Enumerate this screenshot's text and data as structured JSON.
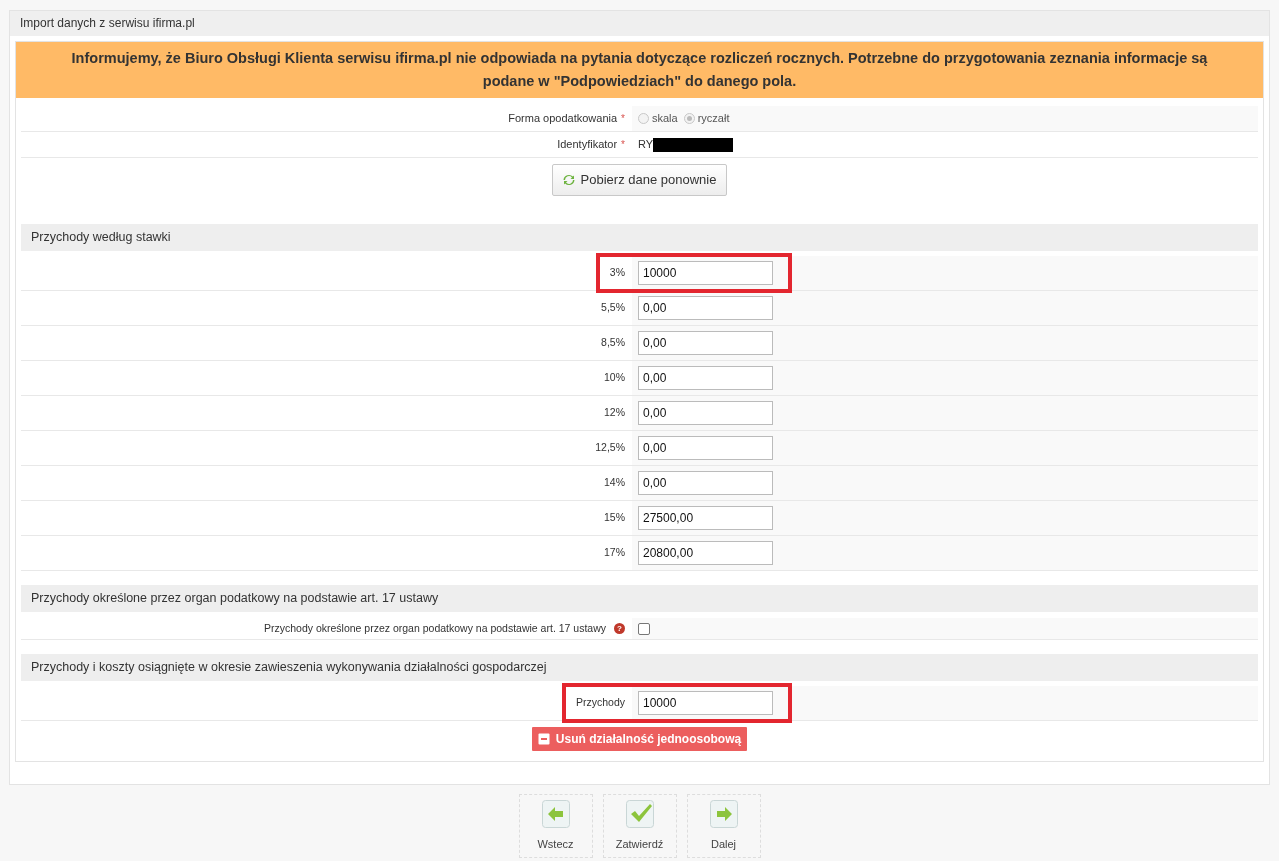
{
  "panel": {
    "title": "Import danych z serwisu ifirma.pl"
  },
  "notice": "Informujemy, że Biuro Obsługi Klienta serwisu ifirma.pl nie odpowiada na pytania dotyczące rozliczeń rocznych. Potrzebne do przygotowania zeznania informacje są podane w \"Podpowiedziach\" do danego pola.",
  "taxation": {
    "label": "Forma opodatkowania",
    "required_mark": "*",
    "options": [
      {
        "label": "skala",
        "selected": false
      },
      {
        "label": "ryczałt",
        "selected": true
      }
    ],
    "disabled": true
  },
  "identifier": {
    "label": "Identyfikator",
    "required_mark": "*",
    "value": "RY",
    "redacted": true
  },
  "refresh_button": "Pobierz dane ponownie",
  "sections": [
    {
      "title": "Przychody według stawki",
      "rows": [
        {
          "kind": "input",
          "label": "3%",
          "value": "10000",
          "highlighted": true
        },
        {
          "kind": "input",
          "label": "5,5%",
          "value": "0,00",
          "highlighted": false
        },
        {
          "kind": "input",
          "label": "8,5%",
          "value": "0,00",
          "highlighted": false
        },
        {
          "kind": "input",
          "label": "10%",
          "value": "0,00",
          "highlighted": false
        },
        {
          "kind": "input",
          "label": "12%",
          "value": "0,00",
          "highlighted": false
        },
        {
          "kind": "input",
          "label": "12,5%",
          "value": "0,00",
          "highlighted": false
        },
        {
          "kind": "input",
          "label": "14%",
          "value": "0,00",
          "highlighted": false
        },
        {
          "kind": "input",
          "label": "15%",
          "value": "27500,00",
          "highlighted": false
        },
        {
          "kind": "input",
          "label": "17%",
          "value": "20800,00",
          "highlighted": false
        }
      ]
    },
    {
      "title": "Przychody określone przez organ podatkowy na podstawie art. 17 ustawy",
      "rows": [
        {
          "kind": "checkbox",
          "label": "Przychody określone przez organ podatkowy na podstawie art. 17 ustawy",
          "checked": false,
          "help_icon": "?",
          "highlighted": false
        }
      ]
    },
    {
      "title": "Przychody i koszty osiągnięte w okresie zawieszenia wykonywania działalności gospodarczej",
      "rows": [
        {
          "kind": "input",
          "label": "Przychody",
          "value": "10000",
          "highlighted": true
        }
      ]
    }
  ],
  "delete_button": "Usuń działalność jednoosobową",
  "nav_buttons": [
    {
      "kind": "back",
      "label": "Wstecz"
    },
    {
      "kind": "confirm",
      "label": "Zatwierdź"
    },
    {
      "kind": "next",
      "label": "Dalej"
    }
  ]
}
